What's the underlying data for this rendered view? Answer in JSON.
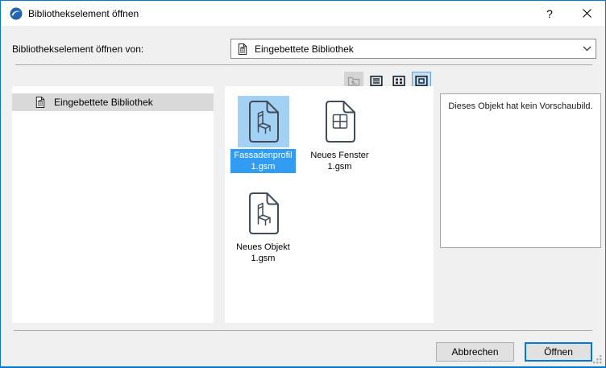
{
  "window": {
    "title": "Bibliothekselement öffnen",
    "help_glyph": "?"
  },
  "open_from": {
    "label": "Bibliothekselement öffnen von:",
    "value": "Eingebettete Bibliothek"
  },
  "toolbar": {
    "buttons": [
      {
        "name": "up-one-level",
        "state": "disabled"
      },
      {
        "name": "list-view",
        "state": "normal"
      },
      {
        "name": "small-icons-view",
        "state": "normal"
      },
      {
        "name": "large-icons-view",
        "state": "selected"
      }
    ]
  },
  "tree": {
    "items": [
      {
        "label": "Eingebettete Bibliothek",
        "icon": "embedded-library-icon",
        "selected": true
      }
    ]
  },
  "files": {
    "items": [
      {
        "name": "Fassadenprofil",
        "line2": "1.gsm",
        "icon": "object-document-icon",
        "selected": true
      },
      {
        "name": "Neues Fenster",
        "line2": "1.gsm",
        "icon": "window-document-icon",
        "selected": false
      },
      {
        "name": "Neues Objekt",
        "line2": "1.gsm",
        "icon": "object-document-icon",
        "selected": false
      }
    ]
  },
  "preview": {
    "message": "Dieses Objekt hat kein Vorschaubild."
  },
  "footer": {
    "cancel_label": "Abbrechen",
    "open_label": "Öffnen"
  },
  "icons": {
    "app": "archicad-logo-icon",
    "library": "embedded-library-icon",
    "object_file": "object-document-icon",
    "window_file": "window-document-icon",
    "close": "close-icon",
    "combo_chevron": "chevron-down-icon",
    "resize": "resize-grip"
  },
  "colors": {
    "accent": "#0078d7",
    "file_selection_label": "#329cf2",
    "file_selection_iconbg": "#a3d1f4",
    "tree_selection": "#d9d9d9",
    "toolbar_selected_bg": "#c4e0f6",
    "toolbar_selected_border": "#66a1d4",
    "dialog_bg": "#f0f0f0"
  }
}
